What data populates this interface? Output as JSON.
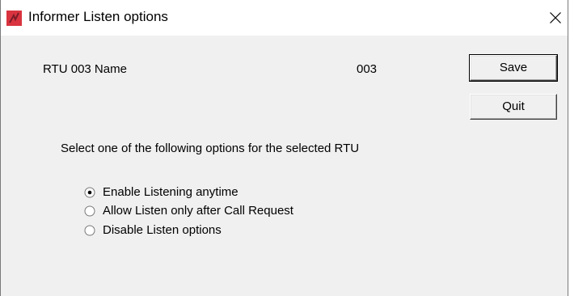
{
  "window": {
    "title": "Informer Listen options",
    "close_glyph": "×"
  },
  "rtu": {
    "name_label": "RTU 003 Name",
    "number": "003"
  },
  "buttons": {
    "save_label": "Save",
    "quit_label": "Quit"
  },
  "instruction": "Select one of the following options for the selected RTU",
  "options": [
    {
      "label": "Enable Listening anytime",
      "selected": true
    },
    {
      "label": "Allow Listen only after Call Request",
      "selected": false
    },
    {
      "label": "Disable Listen options",
      "selected": false
    }
  ],
  "colors": {
    "app_icon": "#d9343f",
    "dialog_bg": "#f0f0f0",
    "titlebar_bg": "#ffffff"
  },
  "icons": {
    "app": "informer-app-icon",
    "close": "close-icon",
    "radio": "radio-button-icon"
  }
}
